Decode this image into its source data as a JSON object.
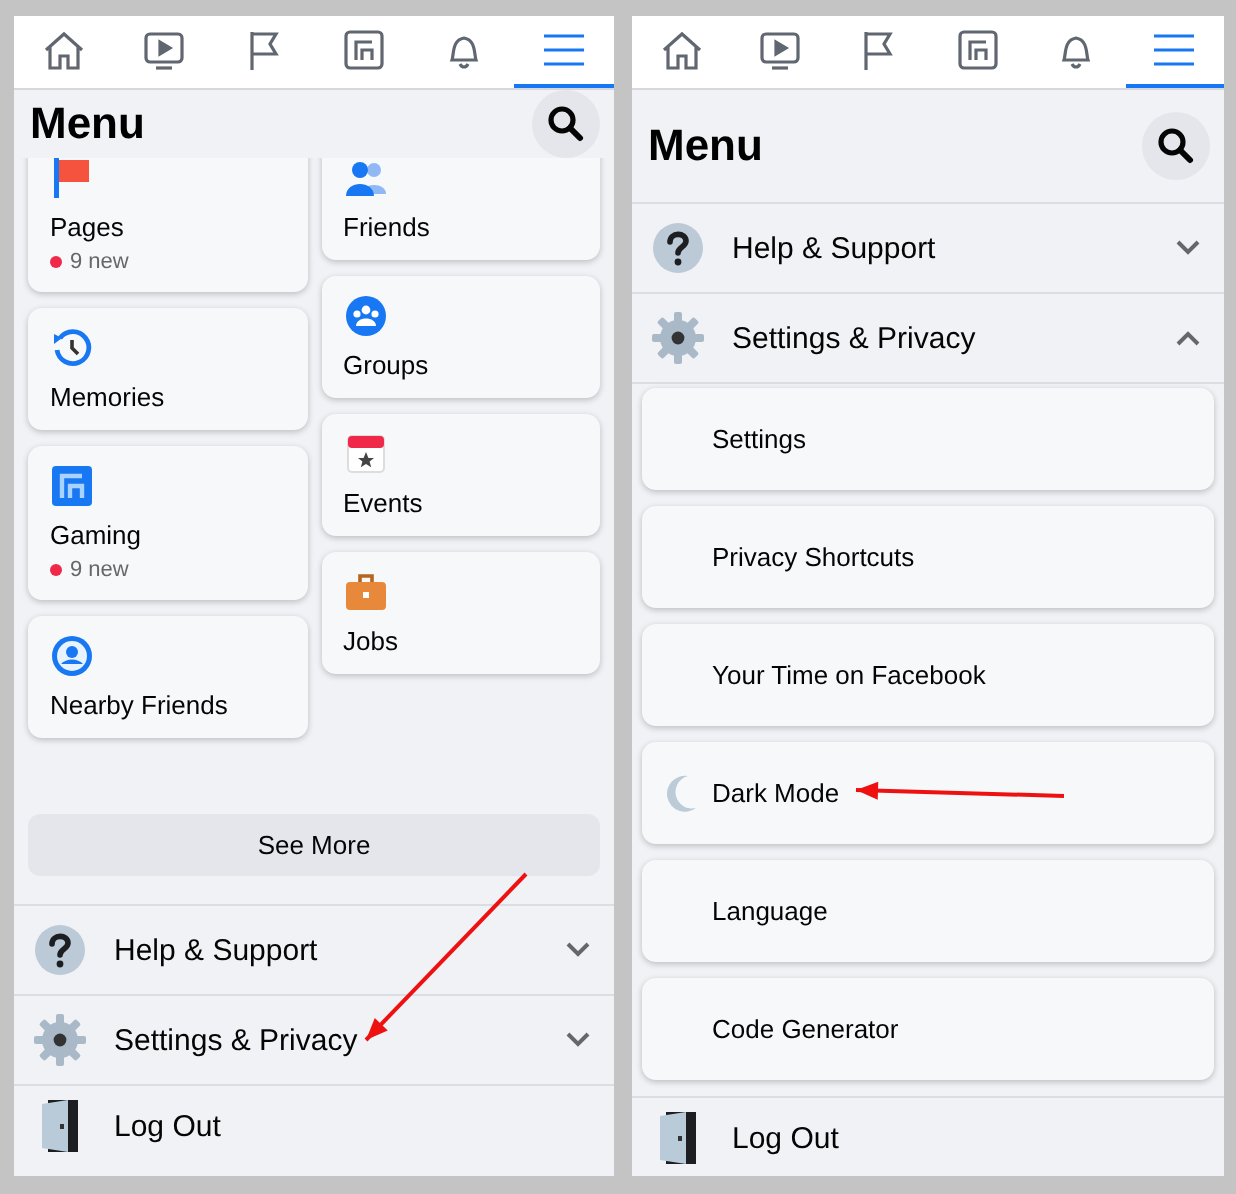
{
  "panels": [
    {
      "nav_tabs": [
        {
          "selected": false
        },
        {
          "selected": false
        },
        {
          "selected": false
        },
        {
          "selected": false
        },
        {
          "selected": false
        },
        {
          "selected": true
        }
      ],
      "title": "Menu",
      "shortcut_columns": [
        [
          {
            "label": "Pages",
            "badge": "9 new"
          },
          {
            "label": "Memories"
          },
          {
            "label": "Gaming",
            "badge": "9 new"
          },
          {
            "label": "Nearby Friends"
          }
        ],
        [
          {
            "label": "Friends"
          },
          {
            "label": "Groups"
          },
          {
            "label": "Events"
          },
          {
            "label": "Jobs"
          }
        ]
      ],
      "see_more": "See More",
      "sections": [
        {
          "label": "Help & Support",
          "expanded": false
        },
        {
          "label": "Settings & Privacy",
          "expanded": false
        }
      ],
      "log_out": "Log Out"
    },
    {
      "nav_tabs": [
        {
          "selected": false
        },
        {
          "selected": false
        },
        {
          "selected": false
        },
        {
          "selected": false
        },
        {
          "selected": false
        },
        {
          "selected": true
        }
      ],
      "title": "Menu",
      "sections": [
        {
          "label": "Help & Support",
          "expanded": false
        },
        {
          "label": "Settings & Privacy",
          "expanded": true,
          "children": [
            {
              "label": "Settings"
            },
            {
              "label": "Privacy Shortcuts"
            },
            {
              "label": "Your Time on Facebook"
            },
            {
              "label": "Dark Mode"
            },
            {
              "label": "Language"
            },
            {
              "label": "Code Generator"
            }
          ]
        }
      ],
      "log_out": "Log Out"
    }
  ]
}
